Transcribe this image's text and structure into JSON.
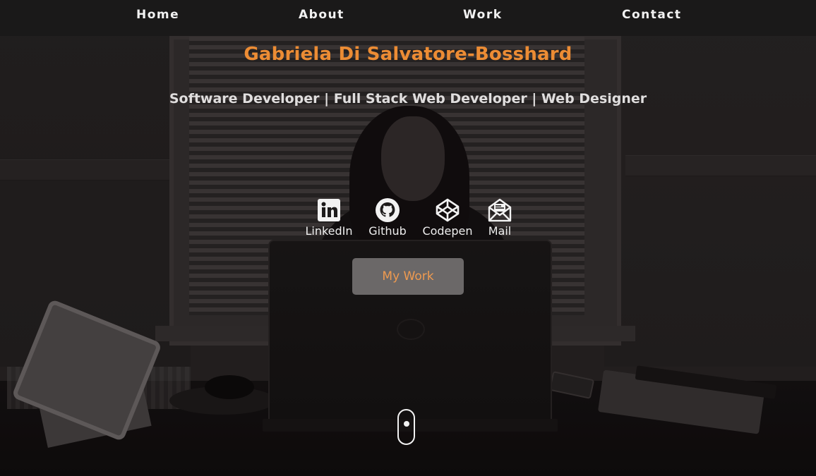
{
  "nav": {
    "items": [
      {
        "label": "Home"
      },
      {
        "label": "About"
      },
      {
        "label": "Work"
      },
      {
        "label": "Contact"
      }
    ]
  },
  "hero": {
    "name": "Gabriela Di Salvatore-Bosshard",
    "subtitle": "Software Developer | Full Stack Web Developer | Web Designer"
  },
  "social": [
    {
      "label": "LinkedIn",
      "icon": "linkedin-icon"
    },
    {
      "label": "Github",
      "icon": "github-icon"
    },
    {
      "label": "Codepen",
      "icon": "codepen-icon"
    },
    {
      "label": "Mail",
      "icon": "mail-icon"
    }
  ],
  "cta": {
    "label": "My Work"
  },
  "colors": {
    "accent": "#ec8c34",
    "nav_bg": "#1a1919",
    "button_bg": "#6b6868"
  }
}
